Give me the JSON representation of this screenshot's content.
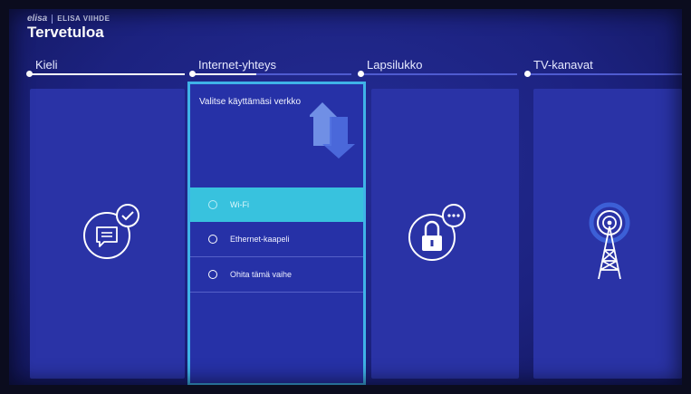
{
  "brand": {
    "logo": "elisa",
    "name": "ELISA VIIHDE"
  },
  "title": "Tervetuloa",
  "steps": [
    {
      "label": "Kieli",
      "state": "done"
    },
    {
      "label": "Internet-yhteys",
      "state": "active"
    },
    {
      "label": "Lapsilukko",
      "state": "upcoming"
    },
    {
      "label": "TV-kanavat",
      "state": "upcoming"
    }
  ],
  "network_panel": {
    "heading": "Valitse käyttämäsi verkko",
    "options": [
      {
        "label": "Wi-Fi",
        "selected": true
      },
      {
        "label": "Ethernet-kaapeli",
        "selected": false
      },
      {
        "label": "Ohita tämä vaihe",
        "selected": false
      }
    ]
  },
  "icons": {
    "language": "chat-check-icon",
    "internet": "network-arrows-icon",
    "parental": "lock-icon",
    "tv": "antenna-tower-icon"
  },
  "colors": {
    "background": "#1c2280",
    "card": "#2a33a6",
    "accent": "#3fb3e8",
    "selected": "#38c2de"
  }
}
